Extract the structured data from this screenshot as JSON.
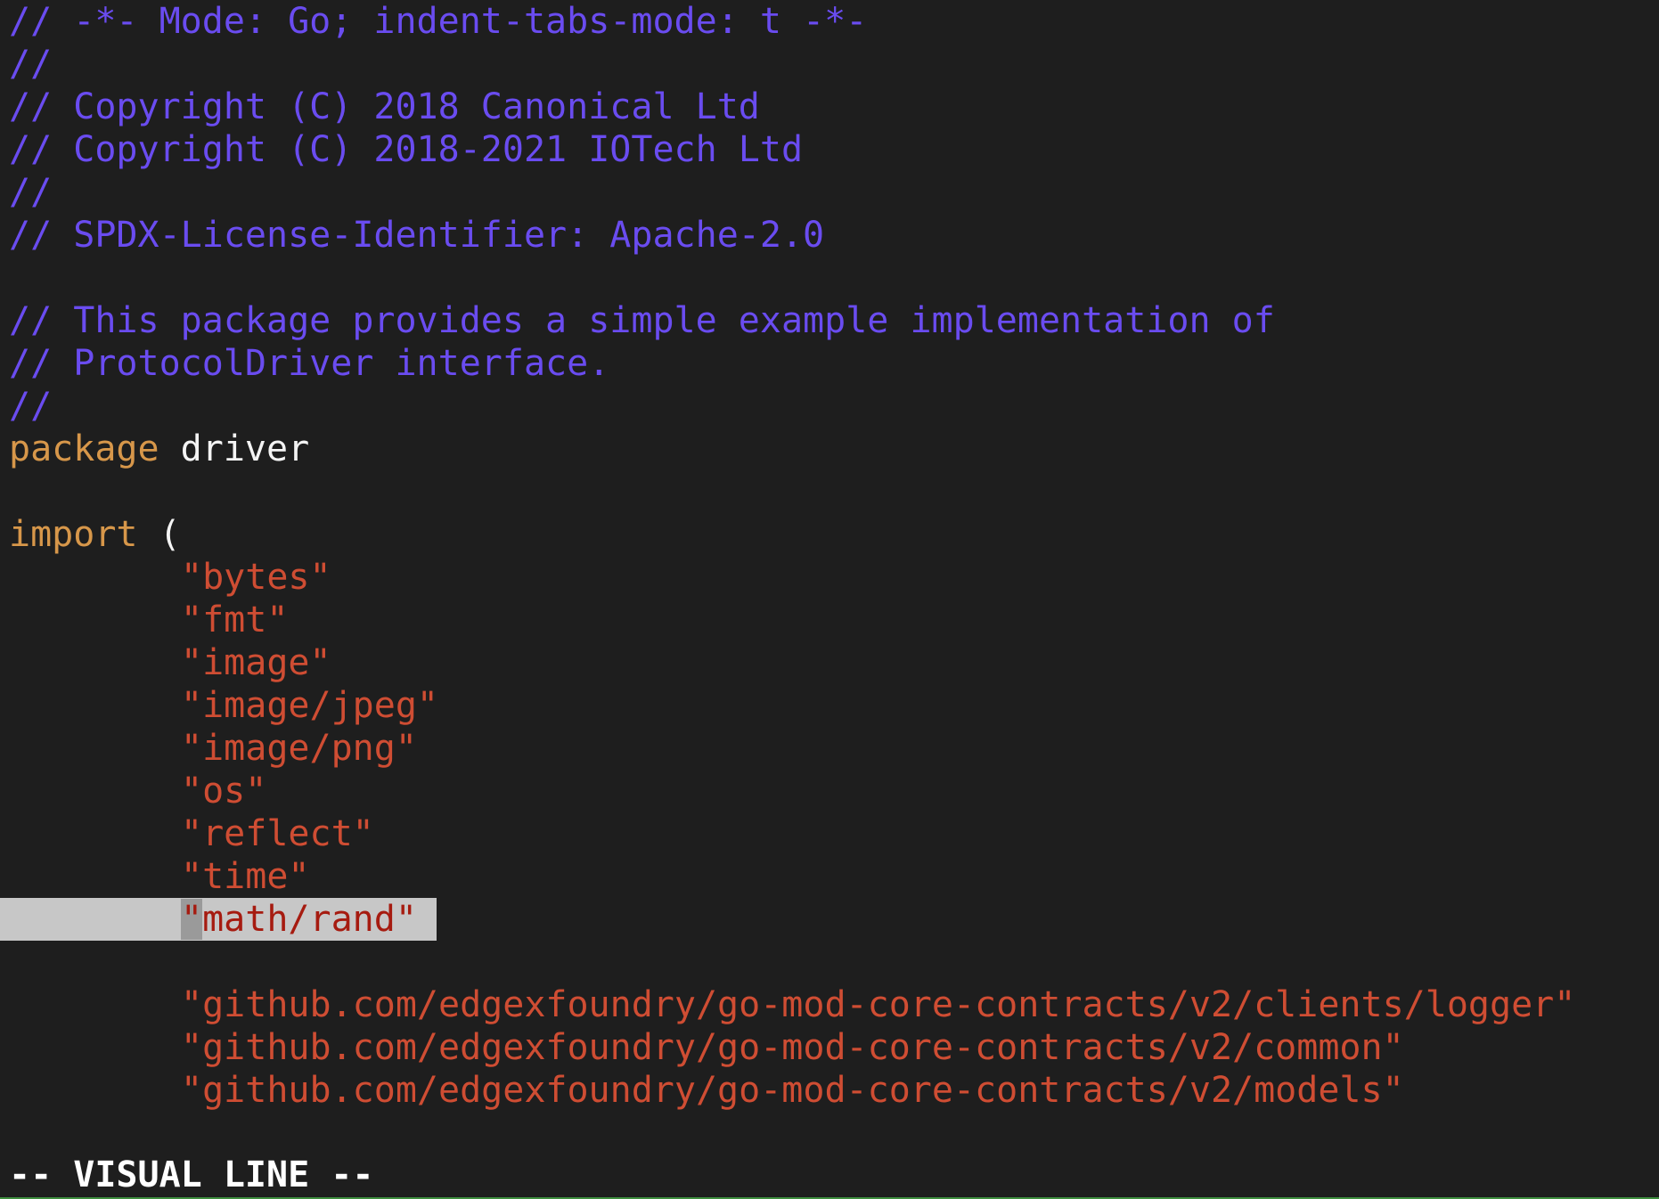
{
  "editor": {
    "lines": [
      {
        "kind": "comment",
        "text": "// -*- Mode: Go; indent-tabs-mode: t -*-"
      },
      {
        "kind": "comment",
        "text": "//"
      },
      {
        "kind": "comment",
        "text": "// Copyright (C) 2018 Canonical Ltd"
      },
      {
        "kind": "comment",
        "text": "// Copyright (C) 2018-2021 IOTech Ltd"
      },
      {
        "kind": "comment",
        "text": "//"
      },
      {
        "kind": "comment",
        "text": "// SPDX-License-Identifier: Apache-2.0"
      },
      {
        "kind": "blank",
        "text": ""
      },
      {
        "kind": "comment",
        "text": "// This package provides a simple example implementation of"
      },
      {
        "kind": "comment",
        "text": "// ProtocolDriver interface."
      },
      {
        "kind": "comment",
        "text": "//"
      },
      {
        "kind": "package",
        "keyword": "package",
        "name": "driver"
      },
      {
        "kind": "blank",
        "text": ""
      },
      {
        "kind": "import",
        "keyword": "import",
        "paren": "("
      },
      {
        "kind": "string",
        "text": "\"bytes\""
      },
      {
        "kind": "string",
        "text": "\"fmt\""
      },
      {
        "kind": "string",
        "text": "\"image\""
      },
      {
        "kind": "string",
        "text": "\"image/jpeg\""
      },
      {
        "kind": "string",
        "text": "\"image/png\""
      },
      {
        "kind": "string",
        "text": "\"os\""
      },
      {
        "kind": "string",
        "text": "\"reflect\""
      },
      {
        "kind": "string",
        "text": "\"time\""
      },
      {
        "kind": "selected",
        "cursor_char": "\"",
        "rest": "math/rand\""
      },
      {
        "kind": "blank",
        "text": ""
      },
      {
        "kind": "string",
        "text": "\"github.com/edgexfoundry/go-mod-core-contracts/v2/clients/logger\""
      },
      {
        "kind": "string",
        "text": "\"github.com/edgexfoundry/go-mod-core-contracts/v2/common\""
      },
      {
        "kind": "string",
        "text": "\"github.com/edgexfoundry/go-mod-core-contracts/v2/models\""
      },
      {
        "kind": "blank",
        "text": ""
      }
    ]
  },
  "status": {
    "mode": "-- VISUAL LINE --"
  },
  "colors": {
    "background": "#1e1e1e",
    "comment": "#6a4cf0",
    "keyword": "#d7974a",
    "identifier": "#f4f4f4",
    "string": "#cf4d33",
    "selection": "#c7c7c7",
    "selection_text": "#a61b10"
  }
}
